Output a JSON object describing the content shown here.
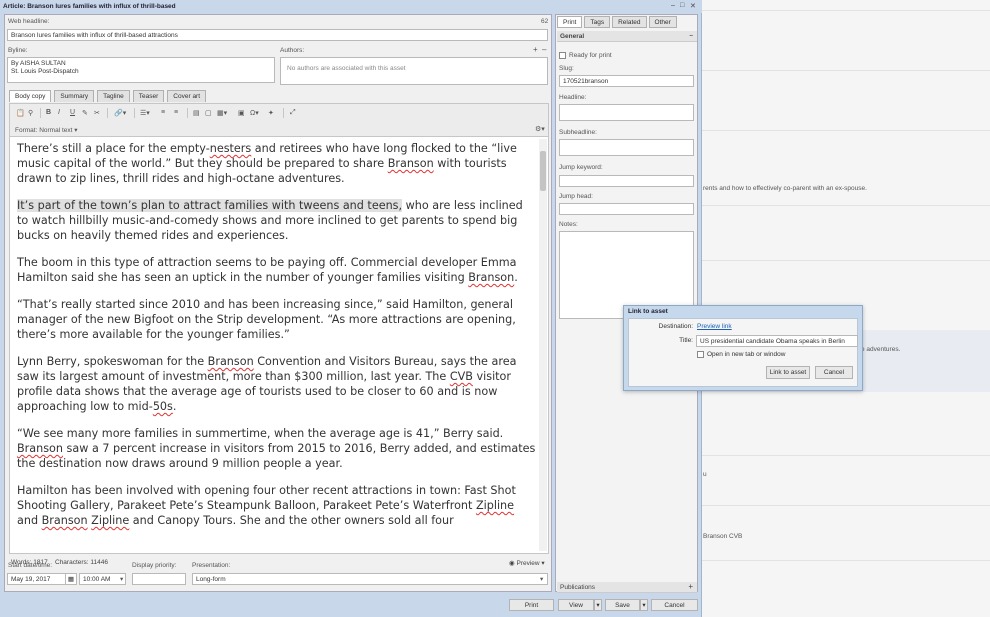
{
  "window": {
    "title": "Article: Branson lures families with influx of thrill-based"
  },
  "fields": {
    "web_headline_label": "Web headline:",
    "web_headline_count": "62",
    "web_headline_value": "Branson lures families with influx of thrill-based attractions",
    "byline_label": "Byline:",
    "byline_line1": "By AISHA SULTAN",
    "byline_line2": "St. Louis Post-Dispatch",
    "authors_label": "Authors:",
    "authors_empty": "No authors are associated with this asset"
  },
  "tabs": [
    "Body copy",
    "Summary",
    "Tagline",
    "Teaser",
    "Cover art"
  ],
  "format_label": "Format: Normal text ▾",
  "body": {
    "p1": [
      "There’s still a place for the empty-",
      "nesters",
      " and retirees who have long flocked to the “live music capital of the world.” But they should be prepared to share ",
      "Branson",
      " with tourists drawn to zip lines, thrill rides and high-octane adventures."
    ],
    "p2_hl": "It’s part of the town’s plan to attract families with tweens and teens,",
    "p2_rest": " who are less inclined to watch hillbilly music-and-comedy shows and more inclined to get parents to spend big bucks on heavily themed rides and experiences.",
    "p3": [
      "The boom in this type of attraction seems to be paying off. Commercial developer Emma Hamilton said she has seen an uptick in the number of younger families visiting ",
      "Branson",
      "."
    ],
    "p4": "“That’s really started since 2010 and has been increasing since,” said Hamilton, general manager of the new Bigfoot on the Strip development. “As more attractions are opening, there’s more available for the younger families.”",
    "p5": [
      "Lynn Berry, spokeswoman for the ",
      "Branson",
      " Convention and Visitors Bureau, says the area saw its largest amount of investment, more than $300 million, last year. The ",
      "CVB",
      " visitor profile data shows that the average age of tourists used to be closer to 60 and is now approaching low to mid-",
      "50s",
      "."
    ],
    "p6": [
      "“We see many more families in summertime, when the average age is 41,” Berry said. ",
      "Branson",
      " saw a 7 percent increase in visitors from 2015 to 2016, Berry added, and estimates the destination now draws around 9 million people a year."
    ],
    "p7": [
      "Hamilton has been involved with opening four other recent attractions in town: Fast Shot Shooting Gallery, Parakeet Pete’s Steampunk Balloon, Parakeet Pete’s Waterfront ",
      "Zipline",
      " and ",
      "Branson",
      " ",
      "Zipline",
      " and Canopy Tours. She and the other owners sold all four"
    ]
  },
  "status": {
    "words": "Words: 1817",
    "chars": "Characters: 11446",
    "preview": "Preview ▾"
  },
  "bottom_fields": {
    "start_label": "Start date/time:",
    "start_date": "May 19, 2017",
    "start_time": "10:00 AM",
    "priority_label": "Display priority:",
    "presentation_label": "Presentation:",
    "presentation_value": "Long-form"
  },
  "right": {
    "tabs": [
      "Print",
      "Tags",
      "Related",
      "Other"
    ],
    "general": "General",
    "ready": "Ready for print",
    "slug_label": "Slug:",
    "slug_value": "170521branson",
    "headline_label": "Headline:",
    "subheadline_label": "Subheadline:",
    "jump_keyword_label": "Jump keyword:",
    "jump_head_label": "Jump head:",
    "notes_label": "Notes:",
    "publications": "Publications"
  },
  "buttons": {
    "print": "Print",
    "view": "View",
    "save": "Save",
    "cancel": "Cancel"
  },
  "dialog": {
    "title": "Link to asset",
    "destination_label": "Destination:",
    "destination_link": "Preview link",
    "title_label": "Title:",
    "title_value": "US presidential candidate Obama speaks in Berlin",
    "newtab": "Open in new tab or window",
    "link_btn": "Link to asset",
    "cancel_btn": "Cancel"
  },
  "background": {
    "t1": "rents and how to effectively co-parent with an ex-spouse.",
    "t2": "e adventures.",
    "t3": " ",
    "t4": "Branson CVB"
  }
}
